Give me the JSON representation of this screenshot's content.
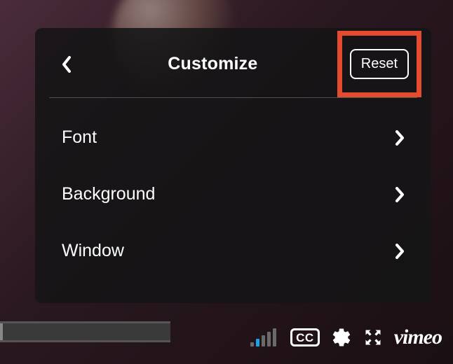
{
  "panel": {
    "title": "Customize",
    "reset_label": "Reset",
    "items": [
      {
        "label": "Font"
      },
      {
        "label": "Background"
      },
      {
        "label": "Window"
      }
    ]
  },
  "controls": {
    "cc_label": "CC",
    "brand": "vimeo"
  },
  "highlight": {
    "color": "#e54b2e"
  }
}
